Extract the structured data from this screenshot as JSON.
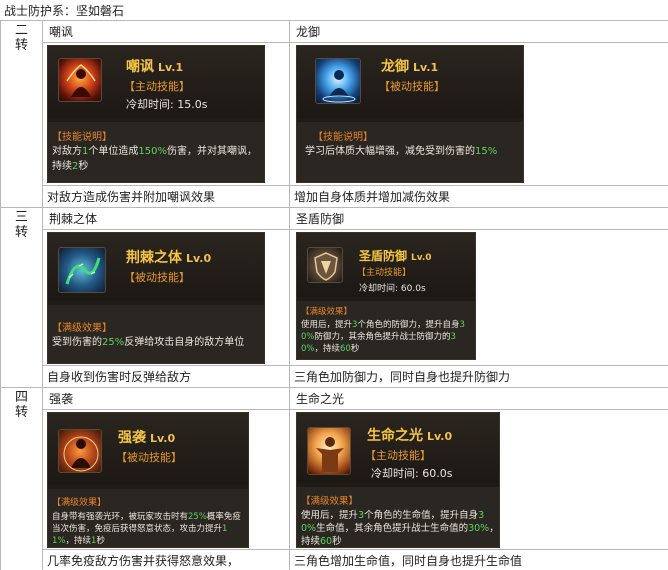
{
  "title": "战士防护系：坚如磐石",
  "colors": {
    "card_bg": "#1f1b17",
    "skill_name": "#f5c542",
    "skill_type": "#e89a2a",
    "highlight": "#5fd35f",
    "header": "#e8842a"
  },
  "tiers": [
    {
      "tier_label": [
        "二",
        "转"
      ],
      "skills": [
        {
          "cell_name": "嘲讽",
          "card": {
            "icon": "taunt-fire-icon",
            "name": "嘲讽",
            "level": "Lv.1",
            "type": "【主动技能】",
            "cooldown_label": "冷却时间:",
            "cooldown_value": "15.0s",
            "header": "【技能说明】",
            "text": [
              "对敌方",
              "1",
              "个单位造成",
              "150%",
              "伤害，并对其嘲讽，持续",
              "2",
              "秒"
            ]
          },
          "summary": "对敌方造成伤害并附加嘲讽效果"
        },
        {
          "cell_name": "龙御",
          "card": {
            "icon": "dragon-guard-icon",
            "name": "龙御",
            "level": "Lv.1",
            "type": "【被动技能】",
            "header": "【技能说明】",
            "text": [
              "学习后体质大幅增强，减免受到伤害的",
              "15%"
            ]
          },
          "summary": "增加自身体质并增加减伤效果"
        }
      ]
    },
    {
      "tier_label": [
        "三",
        "转"
      ],
      "skills": [
        {
          "cell_name": "荆棘之体",
          "card": {
            "icon": "thorn-serpent-icon",
            "name": "荆棘之体",
            "level": "Lv.0",
            "type": "【被动技能】",
            "header": "【满级效果】",
            "text": [
              "受到伤害的",
              "25%",
              "反弹给攻击自身的敌方单位"
            ]
          },
          "summary": "自身收到伤害时反弹给敌方"
        },
        {
          "cell_name": "圣盾防御",
          "card": {
            "icon": "holy-shield-icon",
            "name": "圣盾防御",
            "level": "Lv.0",
            "type": "【主动技能】",
            "cooldown_label": "冷却时间:",
            "cooldown_value": "60.0s",
            "header": "【满级效果】",
            "text": [
              "使用后，提升",
              "3",
              "个角色的防御力，提升自身",
              "30%",
              "防御力，其余角色提升战士防御力的",
              "30%",
              "，持续",
              "60",
              "秒"
            ]
          },
          "summary": "三角色加防御力，同时自身也提升防御力"
        }
      ]
    },
    {
      "tier_label": [
        "四",
        "转"
      ],
      "skills": [
        {
          "cell_name": "强袭",
          "card": {
            "icon": "assault-aura-icon",
            "name": "强袭",
            "level": "Lv.0",
            "type": "【被动技能】",
            "header": "【满级效果】",
            "text": [
              "自身带有强袭光环，被玩家攻击时有",
              "25%",
              "概率免疫当次伤害，免疫后获得怒意状态，攻击力提升",
              "11%",
              "，持续",
              "1",
              "秒"
            ]
          },
          "summary": "几率免疫敌方伤害并获得怒意效果，"
        },
        {
          "cell_name": "生命之光",
          "card": {
            "icon": "life-light-icon",
            "name": "生命之光",
            "level": "Lv.0",
            "type": "【主动技能】",
            "cooldown_label": "冷却时间:",
            "cooldown_value": "60.0s",
            "header": "【满级效果】",
            "text": [
              "使用后，提升",
              "3",
              "个角色的生命值，提升自身",
              "30%",
              "生命值，其余角色提升战士生命值的",
              "30%",
              "，持续",
              "60",
              "秒"
            ]
          },
          "summary": "三角色增加生命值，同时自身也提升生命值"
        }
      ]
    }
  ]
}
